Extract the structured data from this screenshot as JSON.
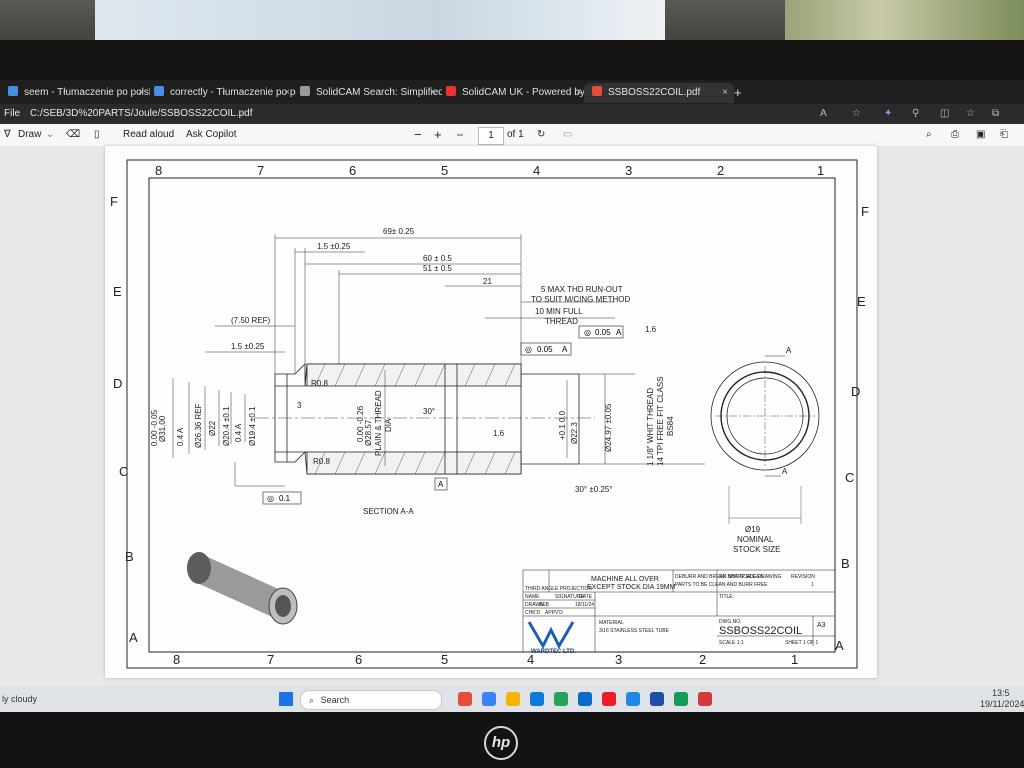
{
  "browser": {
    "tabs": [
      {
        "title": "seem - Tłumaczenie po polsku",
        "fav": "#4a8fe7"
      },
      {
        "title": "correctly - Tłumaczenie po pols",
        "fav": "#4a8fe7"
      },
      {
        "title": "SolidCAM Search: Simplified Em",
        "fav": "#9a9a9a"
      },
      {
        "title": "SolidCAM UK - Powered by Kay",
        "fav": "#e33"
      },
      {
        "title": "SSBOSS22COIL.pdf",
        "fav": "#e74c3c"
      }
    ],
    "new_tab": "+",
    "menu_label": "File",
    "address": "C:/SEB/3D%20PARTS/Joule/SSBOSS22COIL.pdf"
  },
  "pdf_toolbar": {
    "draw_label": "Draw",
    "read_aloud": "Read aloud",
    "ask_copilot": "Ask Copilot",
    "zoom_out": "−",
    "zoom_in": "+",
    "page_value": "1",
    "page_of": "of 1"
  },
  "drawing": {
    "cols_top": [
      "8",
      "7",
      "6",
      "5",
      "4",
      "3",
      "2",
      "1"
    ],
    "rows_side": [
      "F",
      "E",
      "D",
      "C",
      "B",
      "A"
    ],
    "dims": {
      "d69": "69± 0.25",
      "d15a": "1.5 ±0.25",
      "d60": "60 ± 0.5",
      "d51": "51 ± 0.5",
      "d21": "21",
      "d750": "(7.50 REF)",
      "d15b": "1.5 ±0.25",
      "d3": "3",
      "thd1": "5 MAX THD RUN-OUT",
      "thd2": "TO SUIT M/CING METHOD",
      "thd3": "10 MIN FULL",
      "thd4": "THREAD",
      "fc1": "0.05",
      "fc1_ref": "A",
      "fc2": "0.05",
      "fc2_ref": "A",
      "rough": "1.6",
      "r08a": "R0.8",
      "r08b": "R0.8",
      "ang30": "30°",
      "ang30b": "30° ±0.25°",
      "rough2": "1.6",
      "d31": "Ø31.00",
      "d31tol": "0.00 -0.05",
      "fc_a": "0.4 A",
      "d2636": "Ø26.36 REF",
      "d22": "Ø22",
      "d204": "Ø20.4 ±0.1",
      "fc_b": "0.4 A",
      "d194": "Ø19.4 ±0.1",
      "d2857": "Ø28.57",
      "d2857tol": "0.00 -0.26",
      "plain": "PLAIN & THREAD",
      "dia": "DIA",
      "d223": "Ø22.3",
      "d223tol": "+0.1 0.0",
      "d2497": "Ø24.97 ±0.05",
      "wht1": "1 1/8\" WHIT THREAD",
      "wht2": "14 TPI FREE FIT CLASS",
      "wht3": "BS84",
      "datum": "A",
      "fc_bottom": "0.1",
      "section": "SECTION A-A",
      "cut_a_top": "A",
      "cut_a_bottom": "A",
      "d19": "Ø19",
      "nominal": "NOMINAL",
      "stock": "STOCK SIZE"
    },
    "title_block": {
      "projection": "THIRD ANGLE PROJECTION",
      "note1": "MACHINE ALL OVER",
      "note2": "EXCEPT STOCK DIA 19MM",
      "finish": "DEBURR AND BREAK SHARP EDGES",
      "finish2": "PARTS TO BE CLEAN AND BURR FREE",
      "noscale": "DO NOT SCALE DRAWING",
      "revision": "REVISION",
      "rev_val": "1",
      "company": "WARDTEC LTD.",
      "material_label": "MATERIAL",
      "material": "3/16 STAINLESS STEEL TUBE",
      "part_no": "SSBOSS22COIL",
      "size": "A3",
      "scale": "SCALE 1:1",
      "sheet": "SHEET 1 OF 1",
      "title_label": "TITLE:",
      "name": "NAME",
      "signature": "SIGNATURE",
      "date": "DATE",
      "drawn": "DRAWN",
      "drawn_by": "SEB",
      "drawn_date": "18/11/24",
      "chkd": "CHK'D",
      "appvd": "APPV'D",
      "dwg_no": "DWG NO."
    }
  },
  "taskbar": {
    "search": "Search",
    "time": "13:5",
    "date": "19/11/2024",
    "left_text": "ly cloudy",
    "icons": [
      "#e74c3c",
      "#3b82f6",
      "#f4b400",
      "#0a7bd6",
      "#25a35b",
      "#0b6bcb",
      "#ee1c25",
      "#1e88e5",
      "#1e4fa3",
      "#0f9d58",
      "#2b5797",
      "#d23a3a"
    ]
  }
}
